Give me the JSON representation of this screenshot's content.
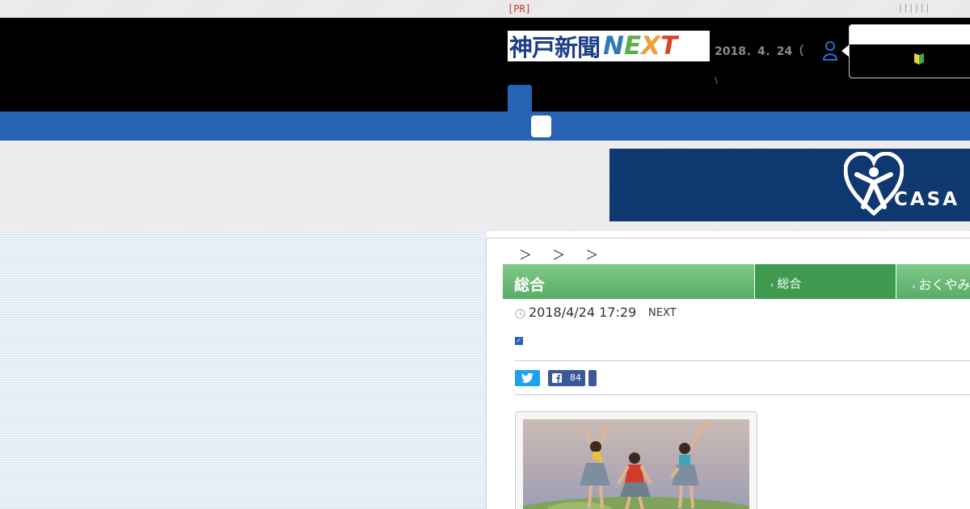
{
  "pr_bar": {
    "label": "[PR]",
    "dots": "||||||"
  },
  "header": {
    "logo": {
      "jp": "神戸新聞",
      "next_letters": [
        "N",
        "E",
        "X",
        "T"
      ]
    },
    "date": "2018．4．24（",
    "tick": "\\",
    "icons": {
      "user": "user-icon",
      "beginner": "beginner-mark-icon"
    }
  },
  "banner": {
    "brand": "CASA"
  },
  "breadcrumb": "＞ ＞ ＞",
  "category": {
    "title": "総合",
    "tabs": [
      {
        "label": "総合",
        "active": true
      },
      {
        "label": "おくやみ",
        "active": false
      }
    ]
  },
  "article": {
    "date": "2018/4/24 17:29",
    "source": "NEXT",
    "share": {
      "facebook_count": "84"
    }
  },
  "colors": {
    "nav_blue": "#2763b5",
    "category_green": "#58ad66",
    "banner_navy": "#0f3770",
    "twitter": "#1da1f2",
    "facebook": "#3b5998"
  }
}
